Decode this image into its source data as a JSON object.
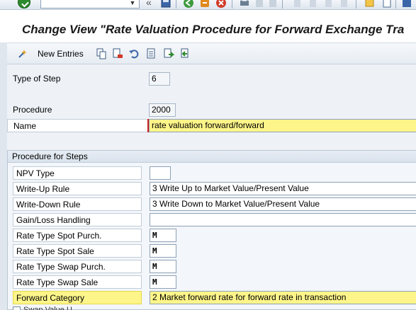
{
  "system_toolbar": {
    "command_field_value": "",
    "icons": [
      "enter-icon",
      "save-icon",
      "back-icon",
      "exit-icon",
      "cancel-icon",
      "print-icon",
      "find-icon",
      "find-next-icon",
      "first-page-icon",
      "previous-page-icon",
      "next-page-icon",
      "last-page-icon",
      "create-session-icon",
      "shortcut-icon",
      "help-icon"
    ]
  },
  "title": "Change View \"Rate Valuation Procedure for Forward Exchange Tra",
  "app_toolbar": {
    "new_entries_label": "New Entries",
    "icons": [
      "new-entries-icon",
      "copy-icon",
      "delete-icon",
      "undo-icon",
      "select-all-icon",
      "next-entry-icon",
      "previous-entry-icon"
    ]
  },
  "header_fields": {
    "type_of_step": {
      "label": "Type of Step",
      "value": "6"
    },
    "procedure": {
      "label": "Procedure",
      "value": "2000"
    },
    "name": {
      "label": "Name",
      "value": "rate valuation forward/forward"
    }
  },
  "procedure_for_steps": {
    "title": "Procedure for Steps",
    "rows": [
      {
        "label": "NPV Type",
        "value": ""
      },
      {
        "label": "Write-Up Rule",
        "value": "3 Write Up to Market Value/Present Value"
      },
      {
        "label": "Write-Down Rule",
        "value": "3 Write Down to Market Value/Present Value"
      },
      {
        "label": "Gain/Loss Handling",
        "value": ""
      },
      {
        "label": "Rate Type Spot Purch.",
        "value": "M"
      },
      {
        "label": "Rate Type Spot Sale",
        "value": "M"
      },
      {
        "label": "Rate Type Swap Purch.",
        "value": "M"
      },
      {
        "label": "Rate Type Swap Sale",
        "value": "M"
      },
      {
        "label": "Forward Category",
        "value": "2 Market forward rate for forward rate in transaction"
      }
    ],
    "cut_off_row_label": "Swap Value U..."
  },
  "colors": {
    "highlight": "#fdf58a",
    "background": "#eef2f7",
    "required_marker": "#cc2222"
  }
}
